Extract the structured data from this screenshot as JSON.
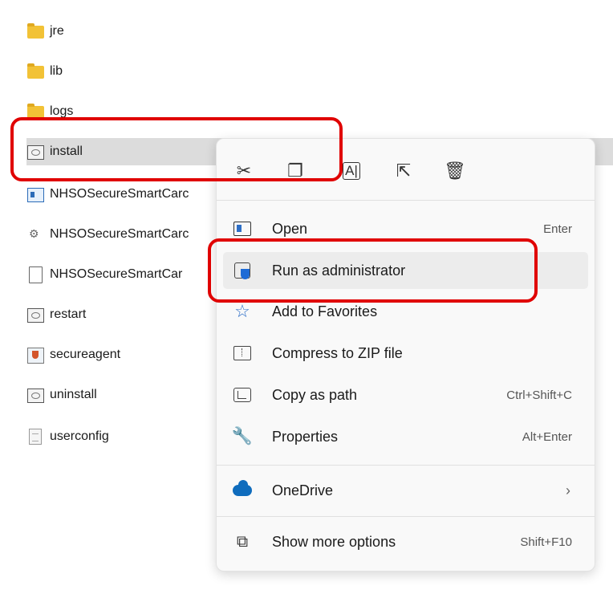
{
  "files": [
    {
      "name": "jre",
      "icon": "folder-icon"
    },
    {
      "name": "lib",
      "icon": "folder-icon"
    },
    {
      "name": "logs",
      "icon": "folder-icon"
    },
    {
      "name": "install",
      "icon": "batch-file-icon"
    },
    {
      "name": "NHSOSecureSmartCarc",
      "icon": "application-icon"
    },
    {
      "name": "NHSOSecureSmartCarc",
      "icon": "config-file-icon"
    },
    {
      "name": "NHSOSecureSmartCar",
      "icon": "blank-file-icon"
    },
    {
      "name": "restart",
      "icon": "batch-file-icon"
    },
    {
      "name": "secureagent",
      "icon": "java-file-icon"
    },
    {
      "name": "uninstall",
      "icon": "batch-file-icon"
    },
    {
      "name": "userconfig",
      "icon": "text-file-icon"
    }
  ],
  "context_menu": {
    "quick_actions": [
      {
        "name": "cut",
        "icon": "scissors-icon"
      },
      {
        "name": "copy",
        "icon": "copy-icon"
      },
      {
        "name": "rename",
        "icon": "rename-icon"
      },
      {
        "name": "share",
        "icon": "share-icon"
      },
      {
        "name": "delete",
        "icon": "trash-icon"
      }
    ],
    "items": [
      {
        "label": "Open",
        "shortcut": "Enter",
        "icon": "open-icon"
      },
      {
        "label": "Run as administrator",
        "shortcut": "",
        "icon": "admin-shield-icon"
      },
      {
        "label": "Add to Favorites",
        "shortcut": "",
        "icon": "star-icon"
      },
      {
        "label": "Compress to ZIP file",
        "shortcut": "",
        "icon": "zip-icon"
      },
      {
        "label": "Copy as path",
        "shortcut": "Ctrl+Shift+C",
        "icon": "copy-path-icon"
      },
      {
        "label": "Properties",
        "shortcut": "Alt+Enter",
        "icon": "properties-wrench-icon"
      },
      {
        "label": "OneDrive",
        "shortcut": "",
        "icon": "onedrive-cloud-icon"
      },
      {
        "label": "Show more options",
        "shortcut": "Shift+F10",
        "icon": "show-more-icon"
      }
    ],
    "chevron": "›"
  },
  "colors": {
    "highlight_border": "#e00000",
    "selection_bg": "#dcdcdc",
    "menu_bg": "#f9f9f9",
    "onedrive_blue": "#0f6cbd",
    "admin_shield_blue": "#1d6bd6"
  }
}
